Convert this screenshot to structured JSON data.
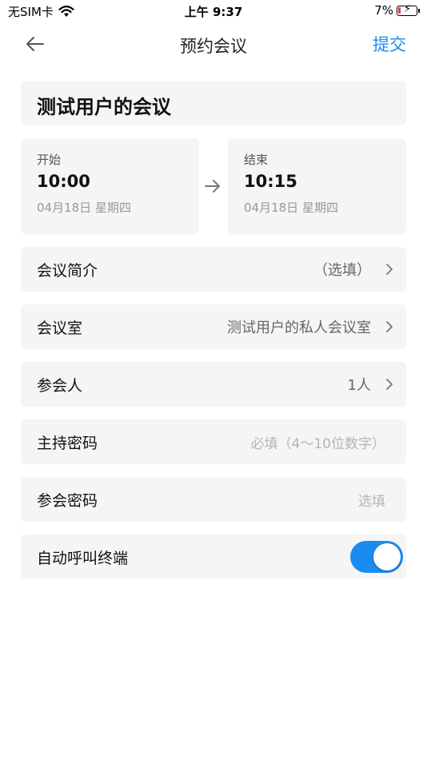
{
  "status_bar": {
    "carrier": "无SIM卡",
    "time": "上午 9:37",
    "battery": "7%"
  },
  "nav": {
    "title": "预约会议",
    "submit_label": "提交"
  },
  "meeting": {
    "title": "测试用户的会议"
  },
  "start": {
    "label": "开始",
    "time": "10:00",
    "date": "04月18日 星期四"
  },
  "end": {
    "label": "结束",
    "time": "10:15",
    "date": "04月18日 星期四"
  },
  "form": {
    "intro": {
      "label": "会议简介",
      "value": "（选填）"
    },
    "room": {
      "label": "会议室",
      "value": "测试用户的私人会议室"
    },
    "participants": {
      "label": "参会人",
      "value": "1人"
    },
    "host_password": {
      "label": "主持密码",
      "placeholder": "必填（4～10位数字）"
    },
    "join_password": {
      "label": "参会密码",
      "placeholder": "选填"
    },
    "auto_call": {
      "label": "自动呼叫终端",
      "enabled": true
    }
  },
  "colors": {
    "accent": "#1a8cf0",
    "card_bg": "#f5f5f5",
    "battery_low": "#e53935"
  }
}
